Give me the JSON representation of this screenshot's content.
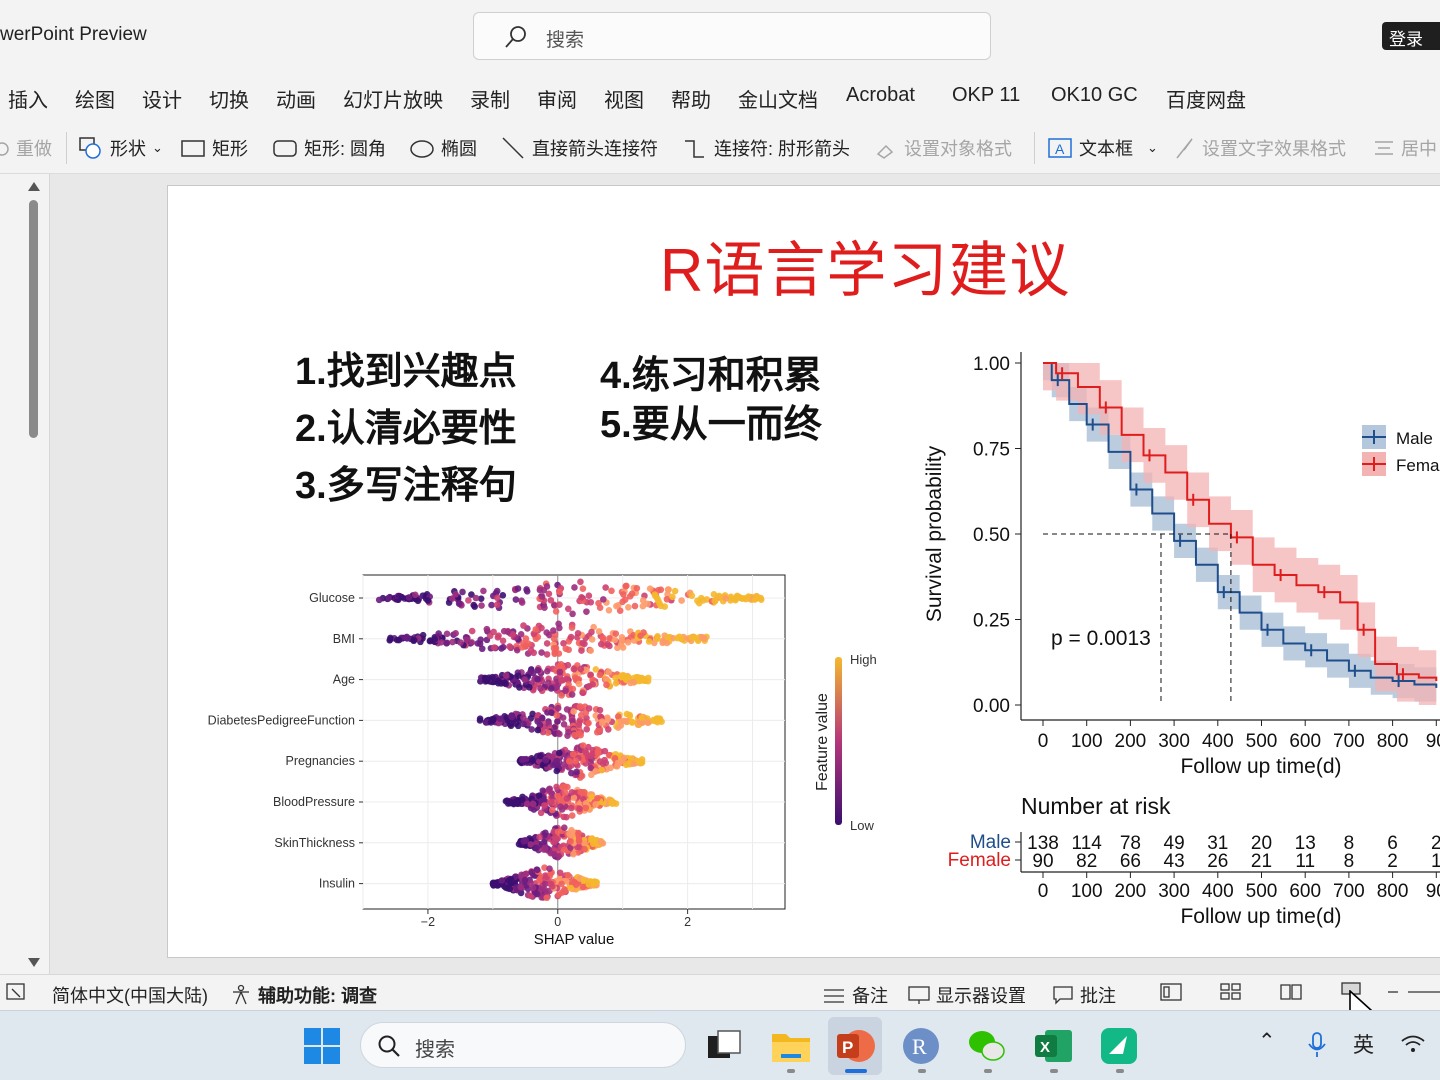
{
  "app": {
    "title": "werPoint Preview",
    "login_label": "登录"
  },
  "search": {
    "placeholder": "搜索"
  },
  "menu": [
    "插入",
    "绘图",
    "设计",
    "切换",
    "动画",
    "幻灯片放映",
    "录制",
    "审阅",
    "视图",
    "帮助",
    "金山文档",
    "Acrobat",
    "OKP 11",
    "OK10 GC",
    "百度网盘"
  ],
  "ribbon": {
    "redo": "重做",
    "shapes": "形状",
    "rect": "矩形",
    "rounded_rect": "矩形: 圆角",
    "ellipse": "椭圆",
    "arrow_connector": "直接箭头连接符",
    "elbow_connector": "连接符: 肘形箭头",
    "format_object": "设置对象格式",
    "textbox": "文本框",
    "text_effects": "设置文字效果格式",
    "center": "居中"
  },
  "slide": {
    "title": "R语言学习建议",
    "tips": [
      "1.找到兴趣点",
      "2.认清必要性",
      "3.多写注释句",
      "4.练习和积累",
      "5.要从一而终"
    ]
  },
  "chart_data": [
    {
      "type": "scatter",
      "subtype": "shap-beeswarm",
      "features": [
        "Glucose",
        "BMI",
        "Age",
        "DiabetesPedigreeFunction",
        "Pregnancies",
        "BloodPressure",
        "SkinThickness",
        "Insulin"
      ],
      "x_ranges": [
        [
          -2.8,
          3.2
        ],
        [
          -2.6,
          2.3
        ],
        [
          -1.2,
          1.4
        ],
        [
          -1.2,
          1.6
        ],
        [
          -0.6,
          1.3
        ],
        [
          -0.8,
          0.9
        ],
        [
          -0.6,
          0.7
        ],
        [
          -1.0,
          0.6
        ]
      ],
      "xlabel": "SHAP value",
      "xticks": [
        "−2",
        "0",
        "2"
      ],
      "xlim": [
        -3.0,
        3.5
      ],
      "color_scale": {
        "label": "Feature value",
        "high": "High",
        "low": "Low",
        "high_color": "#f5b82e",
        "low_color": "#3b0f70"
      }
    },
    {
      "type": "line",
      "subtype": "kaplan-meier",
      "ylabel": "Survival probability",
      "xlabel": "Follow up time(d)",
      "yticks": [
        "0.00",
        "0.25",
        "0.50",
        "0.75",
        "1.00"
      ],
      "xticks": [
        "0",
        "100",
        "200",
        "300",
        "400",
        "500",
        "600",
        "700",
        "800",
        "90"
      ],
      "ylim": [
        0,
        1
      ],
      "xlim": [
        0,
        900
      ],
      "annotation": "p = 0.0013",
      "legend": {
        "position": "right",
        "entries": [
          "Male",
          "Femal"
        ]
      },
      "series": [
        {
          "name": "Male",
          "color": "#1f4e8c",
          "x": [
            0,
            20,
            60,
            100,
            150,
            200,
            250,
            300,
            350,
            400,
            450,
            500,
            550,
            600,
            650,
            700,
            750,
            800,
            850,
            900
          ],
          "y": [
            1.0,
            0.95,
            0.88,
            0.82,
            0.74,
            0.63,
            0.56,
            0.48,
            0.41,
            0.33,
            0.27,
            0.22,
            0.18,
            0.16,
            0.13,
            0.1,
            0.08,
            0.07,
            0.06,
            0.05
          ]
        },
        {
          "name": "Female",
          "color": "#e01d1d",
          "x": [
            0,
            30,
            80,
            130,
            180,
            230,
            280,
            330,
            380,
            430,
            480,
            530,
            580,
            630,
            680,
            720,
            760,
            810,
            860,
            900
          ],
          "y": [
            1.0,
            0.97,
            0.93,
            0.87,
            0.79,
            0.73,
            0.68,
            0.6,
            0.53,
            0.49,
            0.41,
            0.38,
            0.35,
            0.33,
            0.3,
            0.22,
            0.12,
            0.09,
            0.08,
            0.07
          ]
        }
      ],
      "risk_table": {
        "title": "Number at risk",
        "rows": [
          {
            "label": "Male",
            "values": [
              "138",
              "114",
              "78",
              "49",
              "31",
              "20",
              "13",
              "8",
              "6",
              "2"
            ]
          },
          {
            "label": "Female",
            "values": [
              "90",
              "82",
              "66",
              "43",
              "26",
              "21",
              "11",
              "8",
              "2",
              "1"
            ]
          }
        ],
        "xlabel": "Follow up time(d)"
      }
    }
  ],
  "statusbar": {
    "language": "简体中文(中国大陆)",
    "accessibility": "辅助功能: 调查",
    "notes": "备注",
    "display_settings": "显示器设置",
    "comments": "批注"
  },
  "taskbar": {
    "search_placeholder": "搜索",
    "ime": "英"
  }
}
